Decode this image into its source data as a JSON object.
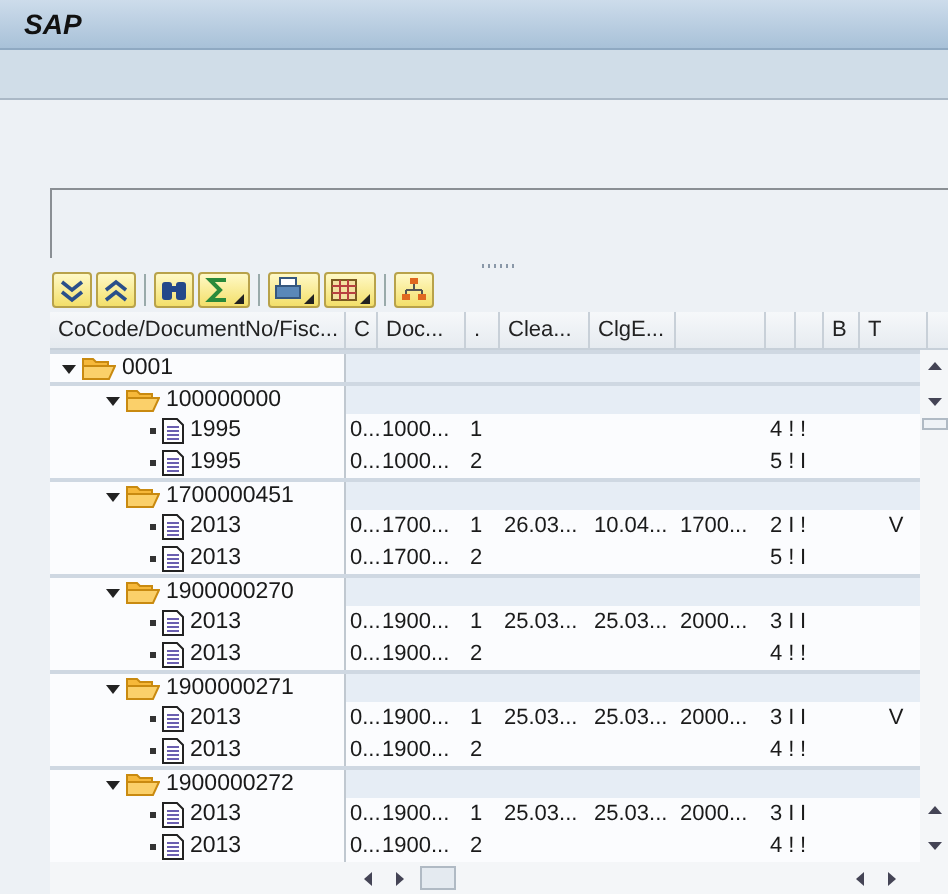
{
  "window": {
    "title": "SAP"
  },
  "toolbar": [
    {
      "kind": "expand",
      "menu": false
    },
    {
      "kind": "collapse",
      "menu": false
    },
    {
      "kind": "find",
      "menu": false
    },
    {
      "kind": "sum",
      "menu": true
    },
    {
      "kind": "print",
      "menu": true
    },
    {
      "kind": "layout",
      "menu": true
    },
    {
      "kind": "hierarchy",
      "menu": false
    }
  ],
  "columns": [
    {
      "label": "CoCode/DocumentNo/Fisc..."
    },
    {
      "label": "C"
    },
    {
      "label": "Doc..."
    },
    {
      "label": "."
    },
    {
      "label": "Clea..."
    },
    {
      "label": "ClgE..."
    },
    {},
    {},
    {},
    {
      "label": "B"
    },
    {
      "label": "T"
    }
  ],
  "tree": [
    {
      "label": "0001",
      "kind": "folder",
      "expanded": true,
      "children": [
        {
          "label": "100000000",
          "kind": "folder",
          "expanded": true,
          "children": [
            {
              "label": "1995",
              "kind": "document",
              "cells": {
                "c": "0...",
                "doc": "1000...",
                "item": "1",
                "col8": "4 !",
                "col9": "!"
              }
            },
            {
              "label": "1995",
              "kind": "document",
              "cells": {
                "c": "0...",
                "doc": "1000...",
                "item": "2",
                "col8": "5 !",
                "col9": "I"
              }
            }
          ]
        },
        {
          "label": "1700000451",
          "kind": "folder",
          "expanded": true,
          "children": [
            {
              "label": "2013",
              "kind": "document",
              "cells": {
                "c": "0...",
                "doc": "1700...",
                "item": "1",
                "clea": "26.03...",
                "clge": "10.04...",
                "col7": "1700...",
                "col8": "2 I",
                "col9": "!",
                "t": "V"
              }
            },
            {
              "label": "2013",
              "kind": "document",
              "cells": {
                "c": "0...",
                "doc": "1700...",
                "item": "2",
                "col8": "5 !",
                "col9": "I"
              }
            }
          ]
        },
        {
          "label": "1900000270",
          "kind": "folder",
          "expanded": true,
          "children": [
            {
              "label": "2013",
              "kind": "document",
              "cells": {
                "c": "0...",
                "doc": "1900...",
                "item": "1",
                "clea": "25.03...",
                "clge": "25.03...",
                "col7": "2000...",
                "col8": "3 I",
                "col9": "I"
              }
            },
            {
              "label": "2013",
              "kind": "document",
              "cells": {
                "c": "0...",
                "doc": "1900...",
                "item": "2",
                "col8": "4 !",
                "col9": "!"
              }
            }
          ]
        },
        {
          "label": "1900000271",
          "kind": "folder",
          "expanded": true,
          "children": [
            {
              "label": "2013",
              "kind": "document",
              "cells": {
                "c": "0...",
                "doc": "1900...",
                "item": "1",
                "clea": "25.03...",
                "clge": "25.03...",
                "col7": "2000...",
                "col8": "3 I",
                "col9": "I",
                "t": "V"
              }
            },
            {
              "label": "2013",
              "kind": "document",
              "cells": {
                "c": "0...",
                "doc": "1900...",
                "item": "2",
                "col8": "4 !",
                "col9": "!"
              }
            }
          ]
        },
        {
          "label": "1900000272",
          "kind": "folder",
          "expanded": true,
          "children": [
            {
              "label": "2013",
              "kind": "document",
              "cells": {
                "c": "0...",
                "doc": "1900...",
                "item": "1",
                "clea": "25.03...",
                "clge": "25.03...",
                "col7": "2000...",
                "col8": "3 I",
                "col9": "I"
              }
            },
            {
              "label": "2013",
              "kind": "document",
              "cells": {
                "c": "0...",
                "doc": "1900...",
                "item": "2",
                "col8": "4 !",
                "col9": "!"
              }
            }
          ]
        }
      ]
    }
  ]
}
